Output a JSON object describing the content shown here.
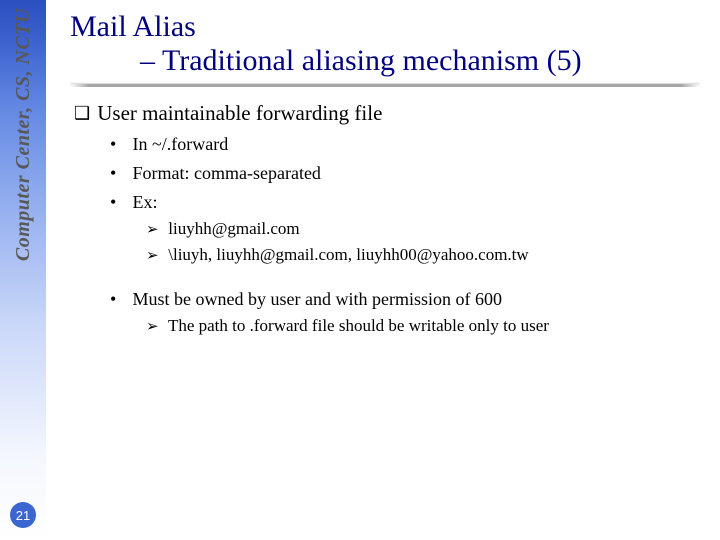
{
  "sidebar": {
    "org": "Computer Center, CS, NCTU",
    "page": "21"
  },
  "title": {
    "main": "Mail Alias",
    "sub": "– Traditional aliasing mechanism (5)"
  },
  "body": {
    "h1": "User maintainable forwarding file",
    "l1": "In ~/.forward",
    "l2": "Format: comma-separated",
    "l3": "Ex:",
    "ex1": "liuyhh@gmail.com",
    "ex2": "\\liuyh, liuyhh@gmail.com, liuyhh00@yahoo.com.tw",
    "l4": "Must be owned by user and with permission of 600",
    "l4a": "The path to .forward file should be writable only to user"
  }
}
